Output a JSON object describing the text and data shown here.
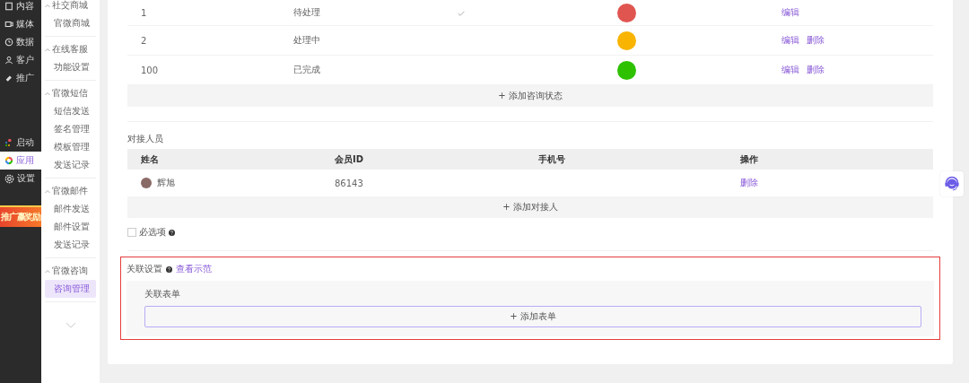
{
  "nav": {
    "items": [
      {
        "label": "内容",
        "selected": false
      },
      {
        "label": "媒体",
        "selected": false
      },
      {
        "label": "数据",
        "selected": false
      },
      {
        "label": "客户",
        "selected": false
      },
      {
        "label": "推广",
        "selected": false
      }
    ],
    "bottom_items": [
      {
        "label": "启动",
        "selected": false
      },
      {
        "label": "应用",
        "selected": true
      },
      {
        "label": "设置",
        "selected": false
      }
    ],
    "promo": "推广赢奖励"
  },
  "submenu": {
    "groups": [
      {
        "title": "社交商城",
        "expanded": true,
        "items": [
          {
            "label": "官微商城",
            "selected": false
          }
        ]
      },
      {
        "title": "在线客服",
        "expanded": true,
        "items": [
          {
            "label": "功能设置",
            "selected": false
          }
        ]
      },
      {
        "title": "官微短信",
        "expanded": true,
        "items": [
          {
            "label": "短信发送",
            "selected": false
          },
          {
            "label": "签名管理",
            "selected": false
          },
          {
            "label": "模板管理",
            "selected": false
          },
          {
            "label": "发送记录",
            "selected": false
          }
        ]
      },
      {
        "title": "官微邮件",
        "expanded": true,
        "items": [
          {
            "label": "邮件发送",
            "selected": false
          },
          {
            "label": "邮件设置",
            "selected": false
          },
          {
            "label": "发送记录",
            "selected": false
          }
        ]
      },
      {
        "title": "官微咨询",
        "expanded": true,
        "items": [
          {
            "label": "咨询管理",
            "selected": true
          }
        ]
      }
    ]
  },
  "status_table": {
    "rows": [
      {
        "value": "1",
        "name": "待处理",
        "default": true,
        "color": "#e05550",
        "actions": [
          "编辑"
        ]
      },
      {
        "value": "2",
        "name": "处理中",
        "default": false,
        "color": "#f8b400",
        "actions": [
          "编辑",
          "删除"
        ]
      },
      {
        "value": "100",
        "name": "已完成",
        "default": false,
        "color": "#2dc100",
        "actions": [
          "编辑",
          "删除"
        ]
      }
    ],
    "add_button": "+ 添加咨询状态"
  },
  "contacts": {
    "title": "对接人员",
    "columns": [
      "姓名",
      "会员ID",
      "手机号",
      "操作"
    ],
    "rows": [
      {
        "name": "辉旭",
        "member_id": "86143",
        "actions": [
          "删除"
        ]
      }
    ],
    "add_button": "+ 添加对接人"
  },
  "required": {
    "label": "必选项",
    "checked": false
  },
  "link_settings": {
    "title": "关联设置",
    "link": "查看示范",
    "highlighted": true,
    "form_label": "关联表单",
    "add_button": "+ 添加表单"
  }
}
